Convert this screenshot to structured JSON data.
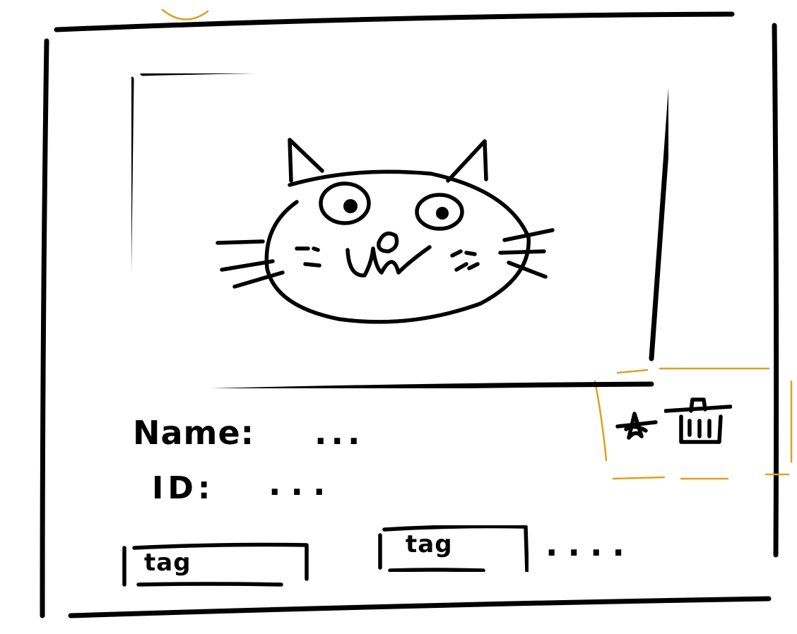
{
  "card": {
    "photo": {
      "icon": "cat-face-icon"
    },
    "fields": {
      "name_label": "Name:",
      "name_value": "...",
      "id_label": "ID:",
      "id_value": "..."
    },
    "actions": {
      "favorite_icon": "star-icon",
      "delete_icon": "trash-icon"
    },
    "tags": [
      {
        "label": "tag"
      },
      {
        "label": "tag"
      }
    ],
    "more_tags": "...."
  },
  "colors": {
    "ink": "#000000",
    "annotation": "#e0a020",
    "background": "#ffffff"
  }
}
